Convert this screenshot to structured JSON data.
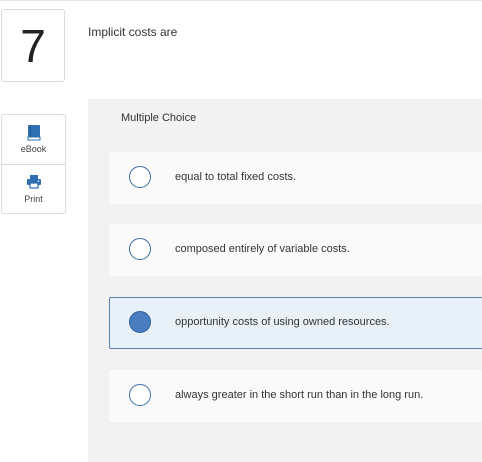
{
  "question": {
    "number": "7",
    "text": "Implicit costs are"
  },
  "tools": [
    {
      "label": "eBook",
      "icon": "book-icon"
    },
    {
      "label": "Print",
      "icon": "printer-icon"
    }
  ],
  "panel": {
    "title": "Multiple Choice",
    "choices": [
      {
        "text": "equal to total fixed costs.",
        "selected": false
      },
      {
        "text": "composed entirely of variable costs.",
        "selected": false
      },
      {
        "text": "opportunity costs of using owned resources.",
        "selected": true
      },
      {
        "text": "always greater in the short run than in the long run.",
        "selected": false
      }
    ]
  },
  "colors": {
    "accent": "#4a7cc0",
    "selected_bg": "#e8f0f8",
    "panel_bg": "#f2f2f2"
  }
}
